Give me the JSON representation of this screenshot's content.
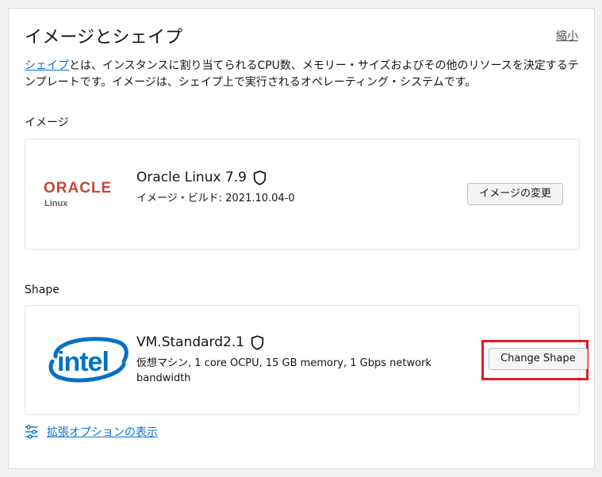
{
  "panel": {
    "title": "イメージとシェイプ",
    "collapse_label": "縮小",
    "description": {
      "link_text": "シェイプ",
      "text": "とは、インスタンスに割り当てられるCPU数、メモリー・サイズおよびその他のリソースを決定するテンプレートです。イメージは、シェイプ上で実行されるオペレーティング・システムです。"
    }
  },
  "image_section": {
    "label": "イメージ",
    "logo": {
      "brand": "ORACLE",
      "sub": "Linux",
      "color": "#c74634"
    },
    "name": "Oracle Linux 7.9",
    "build": "イメージ・ビルド: 2021.10.04-0",
    "change_button": "イメージの変更"
  },
  "shape_section": {
    "label": "Shape",
    "logo": {
      "brand": "intel",
      "color": "#0071c5"
    },
    "name": "VM.Standard2.1",
    "details": "仮想マシン, 1 core OCPU, 15 GB memory, 1 Gbps network bandwidth",
    "change_button": "Change Shape",
    "highlight_color": "#e21d24"
  },
  "advanced": {
    "link_text": "拡張オプションの表示",
    "icon": "sliders-icon"
  }
}
